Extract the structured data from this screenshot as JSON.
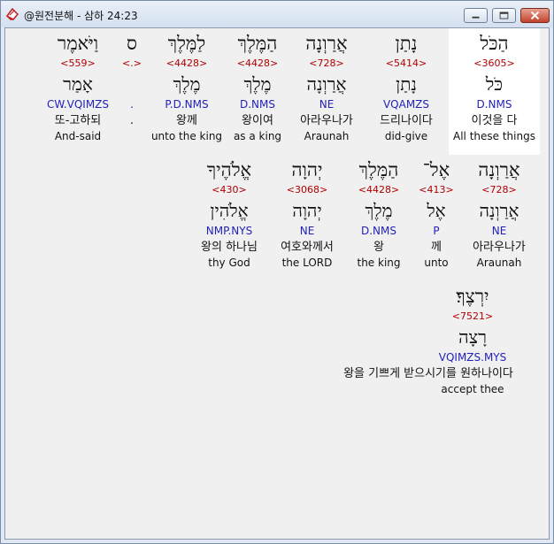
{
  "window": {
    "title": "@원전분해 - 삼하 24:23"
  },
  "rows": [
    {
      "cells": [
        {
          "heb": "הַכֹּל",
          "num": "<3605>",
          "lemma": "כֹּל",
          "parse": "D.NMS",
          "kor": "이것을 다",
          "eng": "All these things"
        },
        {
          "heb": "נָתַן",
          "num": "<5414>",
          "lemma": "נָתַן",
          "parse": "VQAMZS",
          "kor": "드리나이다",
          "eng": "did-give"
        },
        {
          "heb": "אֲרַוְנָה",
          "num": "<728>",
          "lemma": "אֲרַוְנָה",
          "parse": "NE",
          "kor": "아라우나가",
          "eng": "Araunah"
        },
        {
          "heb": "הַמֶּלֶךְ",
          "num": "<4428>",
          "lemma": "מֶלֶךְ",
          "parse": "D.NMS",
          "kor": "왕이여",
          "eng": "as a king"
        },
        {
          "heb": "לַמֶּלֶךְ",
          "num": "<4428>",
          "lemma": "מֶלֶךְ",
          "parse": "P.D.NMS",
          "kor": "왕께",
          "eng": "unto the king"
        },
        {
          "heb": "ס",
          "num": "<.>",
          "lemma": "",
          "parse": ".",
          "kor": ".",
          "eng": ""
        },
        {
          "heb": "וַיֹּאמֶר",
          "num": "<559>",
          "lemma": "אָמַר",
          "parse": "CW.VQIMZS",
          "kor": "또-고하되",
          "eng": "And-said"
        }
      ]
    },
    {
      "cells": [
        {
          "heb": "אֲרַוְנָה",
          "num": "<728>",
          "lemma": "אֲרַוְנָה",
          "parse": "NE",
          "kor": "아라우나가",
          "eng": "Araunah"
        },
        {
          "heb": "אֶל־",
          "num": "<413>",
          "lemma": "אֶל",
          "parse": "P",
          "kor": "께",
          "eng": "unto"
        },
        {
          "heb": "הַמֶּלֶךְ",
          "num": "<4428>",
          "lemma": "מֶלֶךְ",
          "parse": "D.NMS",
          "kor": "왕",
          "eng": "the king"
        },
        {
          "heb": "יְהוָה",
          "num": "<3068>",
          "lemma": "יְהוָה",
          "parse": "NE",
          "kor": "여호와께서",
          "eng": "the LORD"
        },
        {
          "heb": "אֱלֹהֶיךָ",
          "num": "<430>",
          "lemma": "אֱלֹהִין",
          "parse": "NMP.NYS",
          "kor": "왕의 하나님",
          "eng": "thy God"
        }
      ]
    },
    {
      "cells": [
        {
          "heb": "יִרְצֶךָ׃",
          "num": "<7521>",
          "lemma": "רָצָה",
          "parse": "VQIMZS.MYS",
          "kor": "왕을 기쁘게 받으시기를 원하나이다",
          "eng": "accept thee"
        }
      ]
    }
  ]
}
